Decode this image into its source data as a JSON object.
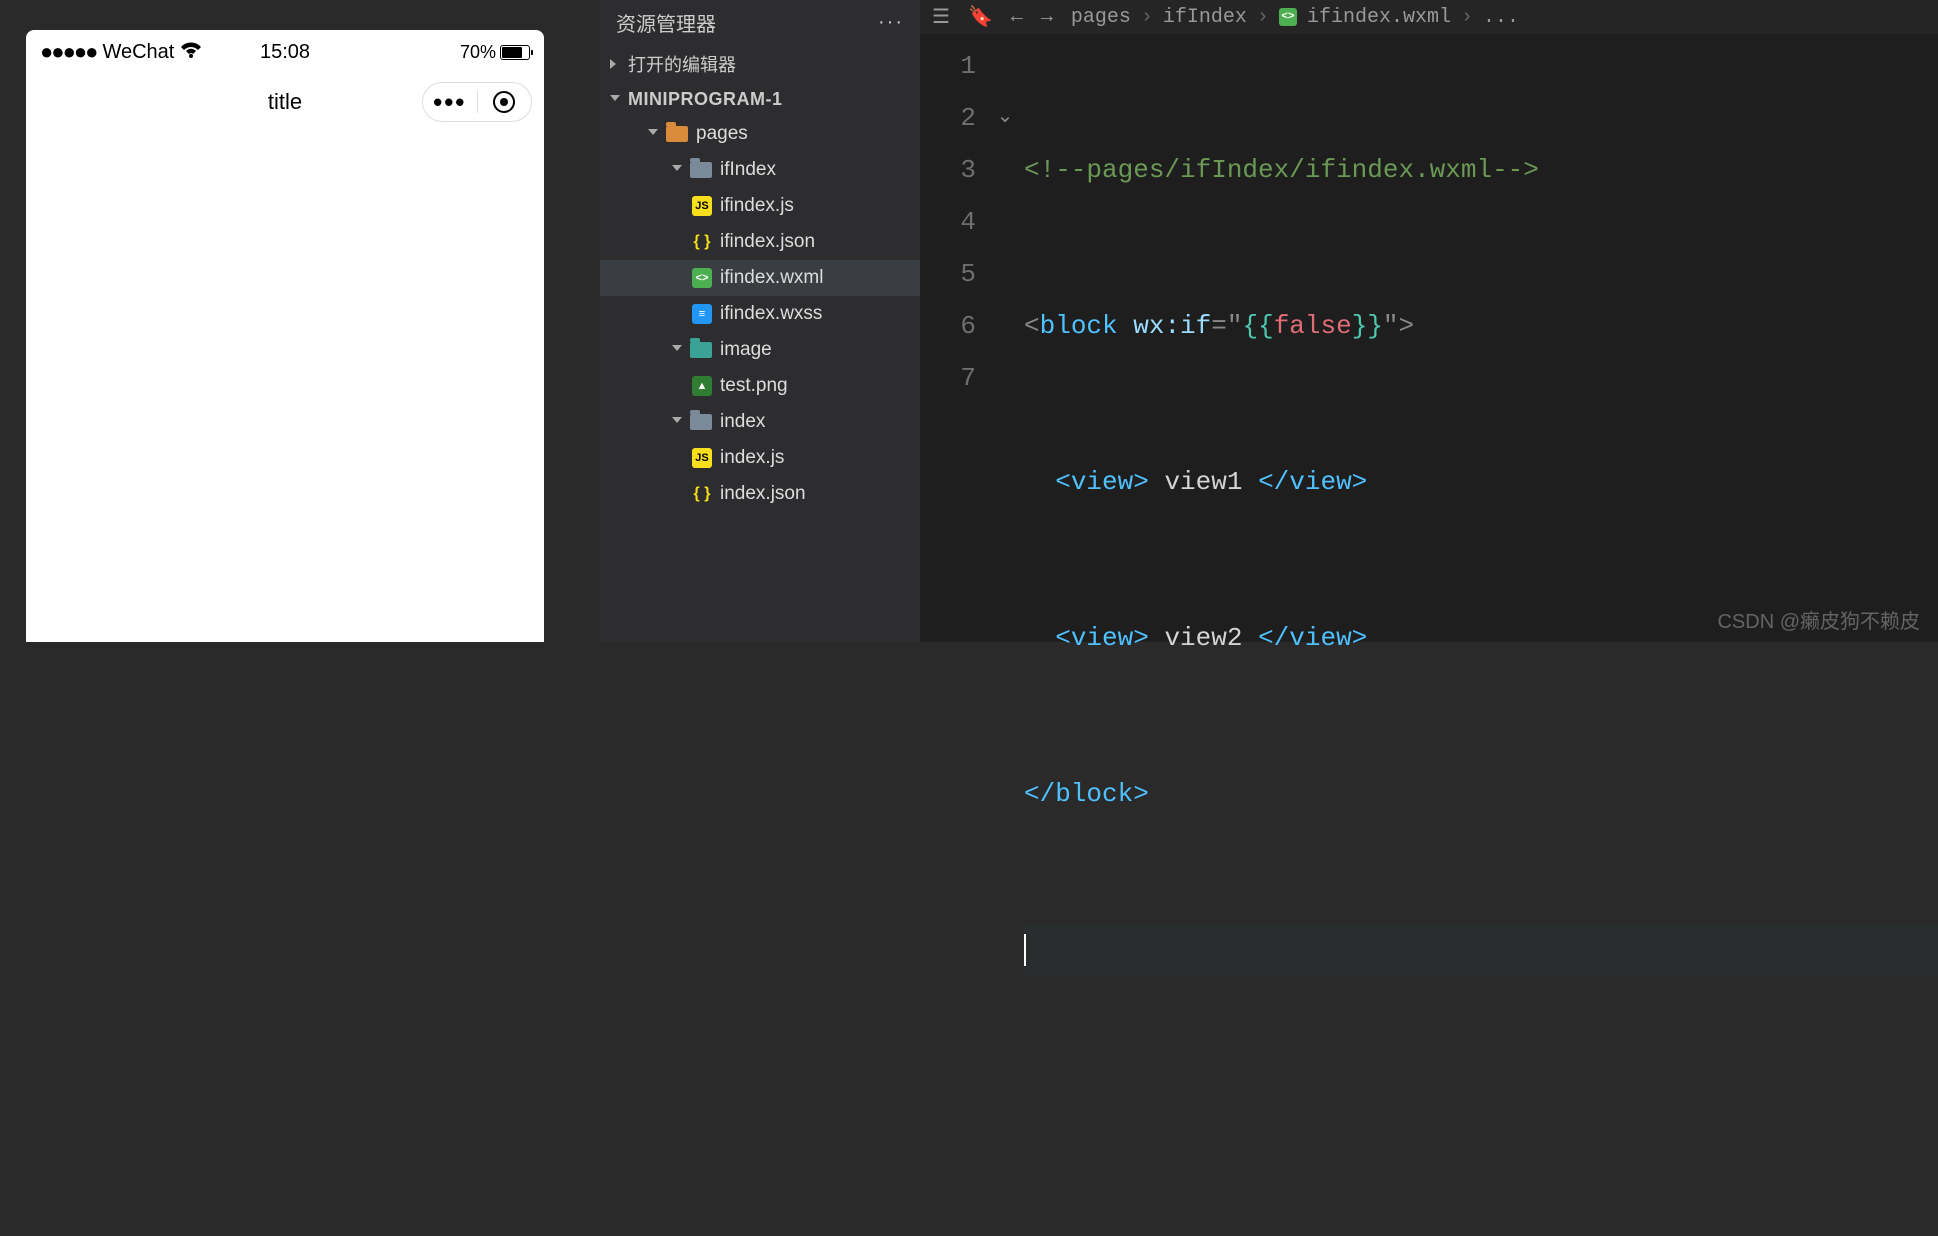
{
  "simulator": {
    "carrier": "WeChat",
    "signal_dots": "●●●●●",
    "time": "15:08",
    "battery_pct": "70%",
    "page_title": "title"
  },
  "explorer": {
    "title": "资源管理器",
    "open_editors": "打开的编辑器",
    "project": "MINIPROGRAM-1",
    "tree": {
      "pages": "pages",
      "ifIndex": "ifIndex",
      "ifindex_js": "ifindex.js",
      "ifindex_json": "ifindex.json",
      "ifindex_wxml": "ifindex.wxml",
      "ifindex_wxss": "ifindex.wxss",
      "image": "image",
      "test_png": "test.png",
      "index": "index",
      "index_js": "index.js",
      "index_json": "index.json"
    }
  },
  "editor": {
    "breadcrumb": {
      "b1": "pages",
      "b2": "ifIndex",
      "b3": "ifindex.wxml",
      "b4": "..."
    },
    "line_numbers": [
      "1",
      "2",
      "3",
      "4",
      "5",
      "6",
      "7"
    ],
    "code": {
      "l1_comment": "<!--pages/ifIndex/ifindex.wxml-->",
      "l2_open_bracket": "<",
      "l2_tag": "block",
      "l2_attr": "wx:if",
      "l2_eq": "=\"",
      "l2_br_open": "{{",
      "l2_lit": "false",
      "l2_br_close": "}}",
      "l2_end": "\">",
      "l3_open": "<view>",
      "l3_text": " view1 ",
      "l3_close": "</view>",
      "l4_open": "<view>",
      "l4_text": " view2 ",
      "l4_close": "</view>",
      "l5_close": "</block>"
    }
  },
  "watermark": "CSDN @癞皮狗不赖皮"
}
